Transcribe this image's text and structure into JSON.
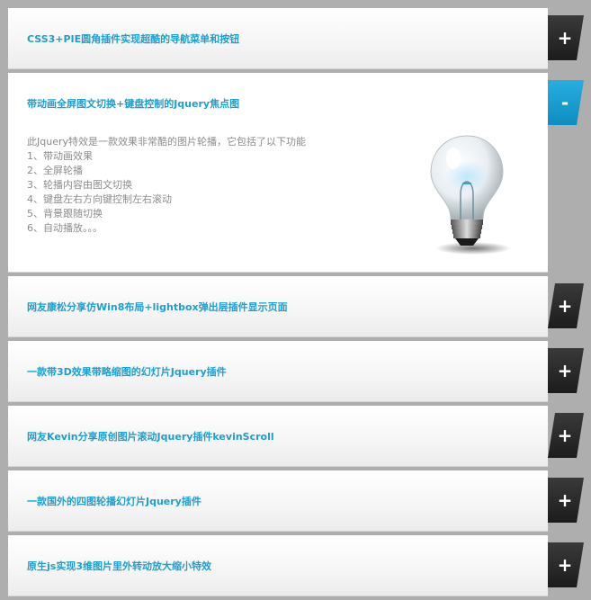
{
  "colors": {
    "accent": "#1e9fcf",
    "toggle_dark": "#2b2b2b",
    "toggle_active": "#1a9fd4",
    "background": "#aeaeae"
  },
  "items": [
    {
      "title": "CSS3+PIE圆角插件实现超酷的导航菜单和按钮",
      "toggle": "+",
      "open": false
    },
    {
      "title": "带动画全屏图文切换+键盘控制的Jquery焦点图",
      "toggle": "-",
      "open": true,
      "content": {
        "lines": [
          "此Jquery特效是一款效果非常酷的图片轮播，它包括了以下功能",
          "1、带动画效果",
          "2、全屏轮播",
          "3、轮播内容由图文切换",
          "4、键盘左右方向键控制左右滚动",
          "5、背景跟随切换",
          "6、自动播放。。。"
        ],
        "image_icon": "lightbulb-image"
      }
    },
    {
      "title": "网友康松分享仿Win8布局+lightbox弹出层插件显示页面",
      "toggle": "+",
      "open": false
    },
    {
      "title": "一款带3D效果带略缩图的幻灯片Jquery插件",
      "toggle": "+",
      "open": false
    },
    {
      "title": "网友Kevin分享原创图片滚动Jquery插件kevinScroll",
      "toggle": "+",
      "open": false
    },
    {
      "title": "一款国外的四图轮播幻灯片Jquery插件",
      "toggle": "+",
      "open": false
    },
    {
      "title": "原生js实现3维图片里外转动放大缩小特效",
      "toggle": "+",
      "open": false
    }
  ]
}
